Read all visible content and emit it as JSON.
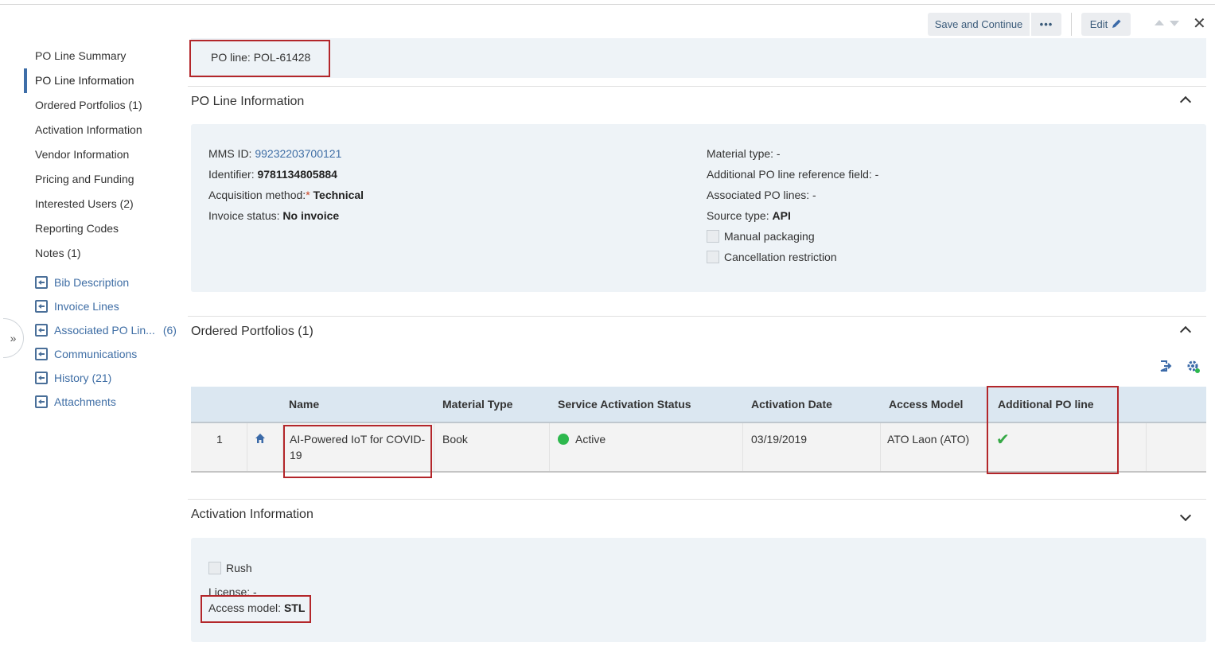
{
  "toolbar": {
    "save_label": "Save and Continue",
    "more_label": "•••",
    "edit_label": "Edit",
    "close_label": "✕"
  },
  "sidebar": {
    "items": [
      {
        "label": "PO Line Summary"
      },
      {
        "label": "PO Line Information",
        "active": true
      },
      {
        "label": "Ordered Portfolios (1)"
      },
      {
        "label": "Activation Information"
      },
      {
        "label": "Vendor Information"
      },
      {
        "label": "Pricing and Funding"
      },
      {
        "label": "Interested Users (2)"
      },
      {
        "label": "Reporting Codes"
      },
      {
        "label": "Notes (1)"
      }
    ],
    "links": [
      {
        "label": "Bib Description",
        "count": ""
      },
      {
        "label": "Invoice Lines",
        "count": ""
      },
      {
        "label": "Associated PO Lin...",
        "count": "(6)"
      },
      {
        "label": "Communications",
        "count": ""
      },
      {
        "label": "History (21)",
        "count": ""
      },
      {
        "label": "Attachments",
        "count": ""
      }
    ],
    "expander": "»"
  },
  "header": {
    "po_line": "PO line: POL-61428"
  },
  "po_line_info": {
    "title": "PO Line Information",
    "mms_id_label": "MMS ID: ",
    "mms_id": "99232203700121",
    "identifier_label": "Identifier: ",
    "identifier": "9781134805884",
    "acq_method_label": "Acquisition method:",
    "acq_required": "*",
    "acq_method": " Technical",
    "invoice_status_label": "Invoice status: ",
    "invoice_status": "No invoice",
    "material_type": "Material type: -",
    "additional_ref": "Additional PO line reference field: -",
    "associated_lines": "Associated PO lines: -",
    "source_type_label": "Source type: ",
    "source_type": "API",
    "manual_packaging": "Manual packaging",
    "cancellation_restriction": "Cancellation restriction"
  },
  "ordered_portfolios": {
    "title": "Ordered Portfolios (1)",
    "columns": [
      "Name",
      "Material Type",
      "Service Activation Status",
      "Activation Date",
      "Access Model",
      "Additional PO line"
    ],
    "rows": [
      {
        "index": "1",
        "name_line1": "AI-Powered IoT for COVID-",
        "name_line2": "19",
        "material_type": "Book",
        "status": "Active",
        "activation_date": "03/19/2019",
        "access_model": "ATO Laon (ATO)",
        "additional_po_line": "✔"
      }
    ]
  },
  "activation_info": {
    "title": "Activation Information",
    "rush": "Rush",
    "license": "License: -",
    "access_model_label": "Access model: ",
    "access_model": "STL"
  },
  "colors": {
    "accent": "#3f6ea5",
    "highlight_box": "#b3262a",
    "active_status": "#2db84d",
    "panel_bg": "#eef3f7",
    "table_header_bg": "#dbe7f1"
  }
}
